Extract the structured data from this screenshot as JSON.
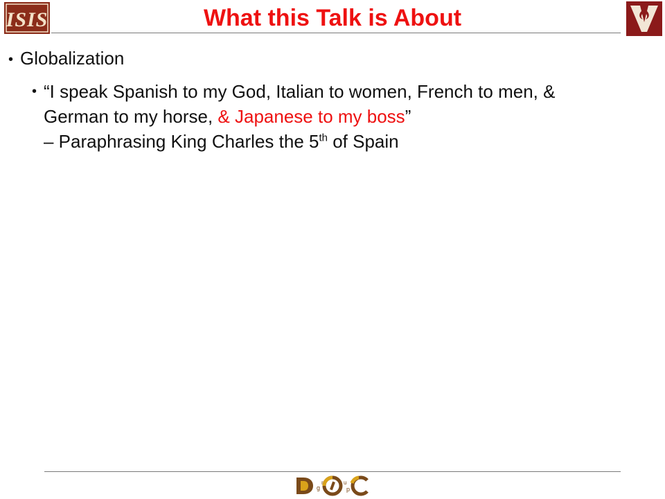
{
  "slide": {
    "title": "What this Talk is About",
    "bullets": [
      {
        "level": 1,
        "text": "Globalization"
      },
      {
        "level": 2,
        "quote_part1": "“I speak Spanish to my God, Italian to women, French to men, & German to my horse, ",
        "quote_red": "& Japanese to my boss",
        "quote_close": "”",
        "attribution_part1": " – Paraphrasing King Charles the 5",
        "attribution_sup": "th",
        "attribution_part2": " of Spain"
      }
    ]
  },
  "logos": {
    "left": "ISIS",
    "right": "V",
    "footer": {
      "d": "D",
      "g": "g",
      "r": "r",
      "o": "O",
      "i": "i",
      "u": "u",
      "c": "C",
      "p": "p"
    }
  },
  "colors": {
    "title": "#ee1111",
    "highlight": "#ee1111",
    "body_text": "#111111",
    "isis_logo": "#8b2d1a",
    "v_logo": "#8b1a1a",
    "doc_logo_brown": "#7a4a1a",
    "doc_logo_gold": "#d9a21a"
  }
}
